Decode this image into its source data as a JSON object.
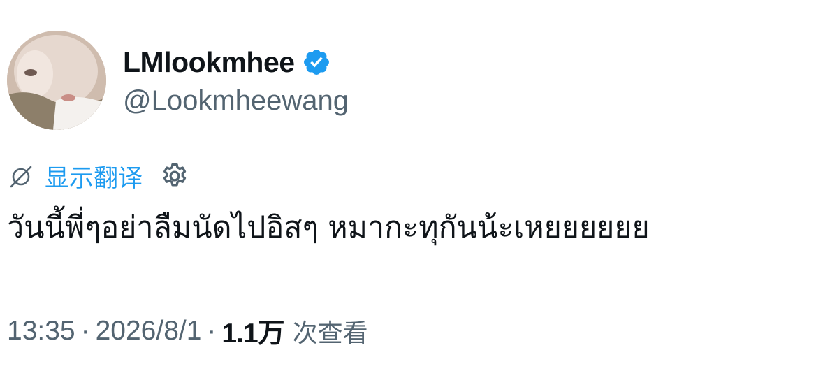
{
  "author": {
    "display_name": "LMlookmhee",
    "handle": "@Lookmheewang",
    "verified": true
  },
  "translate": {
    "label": "显示翻译"
  },
  "tweet": {
    "text": "วันนี้พี่ๆอย่าลืมนัดไปอิสๆ หมากะทุกันน้ะเหยยยยยย"
  },
  "meta": {
    "time": "13:35",
    "separator": "·",
    "date": "2026/8/1",
    "view_count": "1.1万",
    "views_label": "次查看"
  },
  "colors": {
    "accent": "#1d9bf0",
    "secondary_text": "#536471",
    "primary_text": "#0f1419"
  },
  "icons": {
    "verified": "verified-badge-icon",
    "translate": "globe-slash-icon",
    "settings": "gear-icon"
  }
}
